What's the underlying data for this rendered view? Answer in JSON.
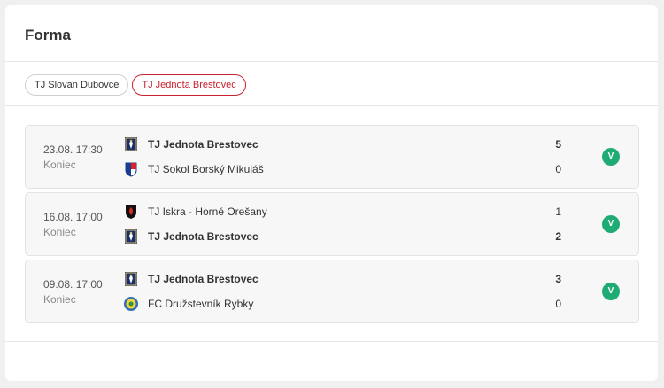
{
  "header": {
    "title": "Forma"
  },
  "tabs": [
    {
      "label": "TJ Slovan Dubovce",
      "active": false
    },
    {
      "label": "TJ Jednota Brestovec",
      "active": true
    }
  ],
  "colors": {
    "accent": "#c8202f",
    "win": "#1fab74"
  },
  "matches": [
    {
      "date": "23.08. 17:30",
      "status": "Koniec",
      "home": {
        "name": "TJ Jednota Brestovec",
        "score": "5",
        "icon": "brestovec-crest-icon"
      },
      "away": {
        "name": "TJ Sokol Borský Mikuláš",
        "score": "0",
        "icon": "sokol-borsky-mikulas-crest-icon"
      },
      "result": "V"
    },
    {
      "date": "16.08. 17:00",
      "status": "Koniec",
      "home": {
        "name": "TJ Iskra - Horné Orešany",
        "score": "1",
        "icon": "iskra-horne-oresany-crest-icon"
      },
      "away": {
        "name": "TJ Jednota Brestovec",
        "score": "2",
        "icon": "brestovec-crest-icon"
      },
      "result": "V"
    },
    {
      "date": "09.08. 17:00",
      "status": "Koniec",
      "home": {
        "name": "TJ Jednota Brestovec",
        "score": "3",
        "icon": "brestovec-crest-icon"
      },
      "away": {
        "name": "FC Družstevník Rybky",
        "score": "0",
        "icon": "druzstevnik-rybky-crest-icon"
      },
      "result": "V"
    }
  ]
}
